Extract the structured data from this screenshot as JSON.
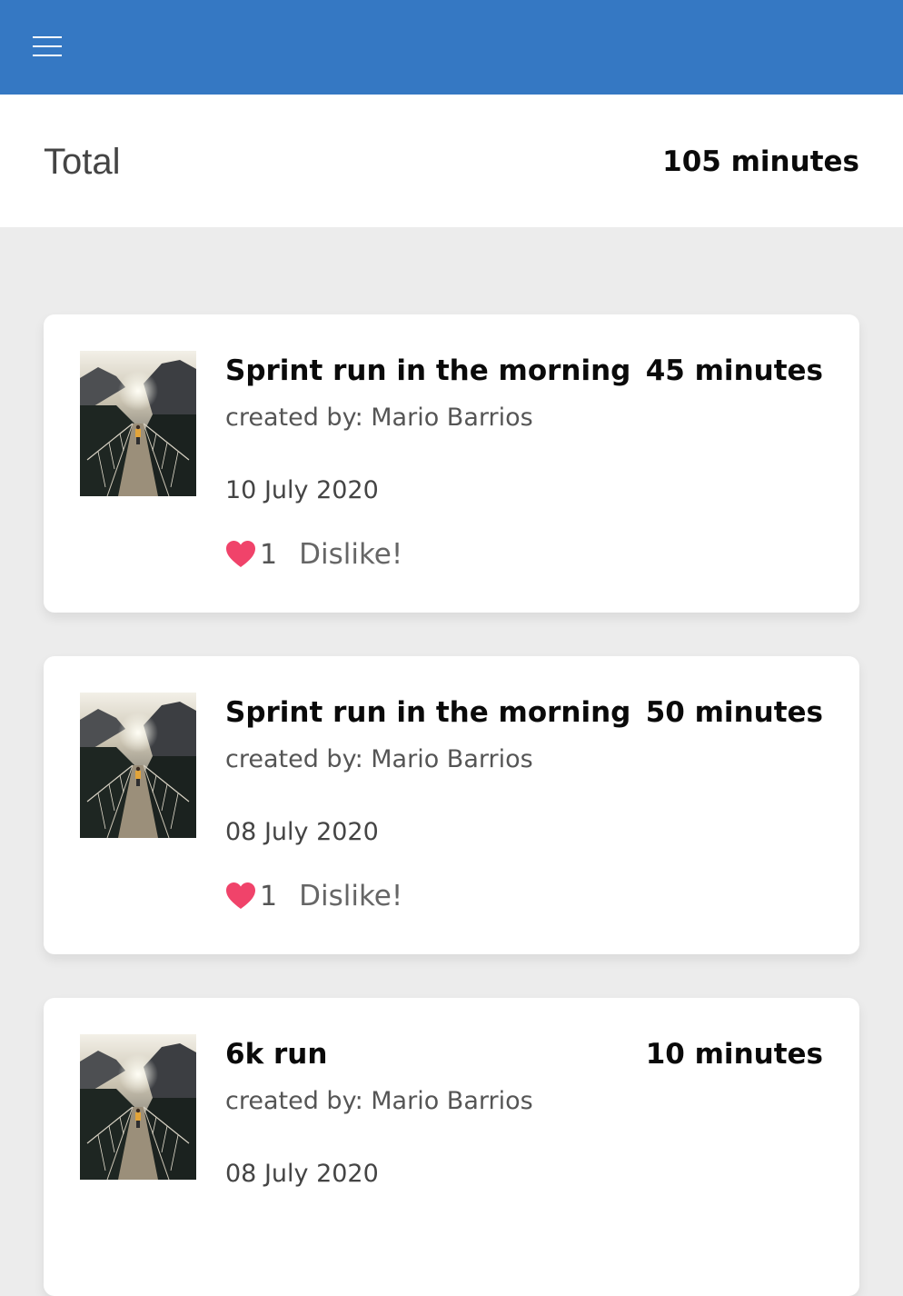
{
  "header": {
    "menu_icon": "hamburger-menu-icon",
    "color": "#3578c3"
  },
  "summary": {
    "label": "Total",
    "value": "105 minutes"
  },
  "activities": [
    {
      "title": "Sprint run in the morning",
      "duration": "45 minutes",
      "author": "created by: Mario Barrios",
      "date": "10 July 2020",
      "likes": "1",
      "dislike_label": "Dislike!"
    },
    {
      "title": "Sprint run in the morning",
      "duration": "50 minutes",
      "author": "created by: Mario Barrios",
      "date": "08 July 2020",
      "likes": "1",
      "dislike_label": "Dislike!"
    },
    {
      "title": "6k run",
      "duration": "10 minutes",
      "author": "created by: Mario Barrios",
      "date": "08 July 2020"
    }
  ],
  "colors": {
    "heart": "#f0436a",
    "background": "#ececec"
  }
}
